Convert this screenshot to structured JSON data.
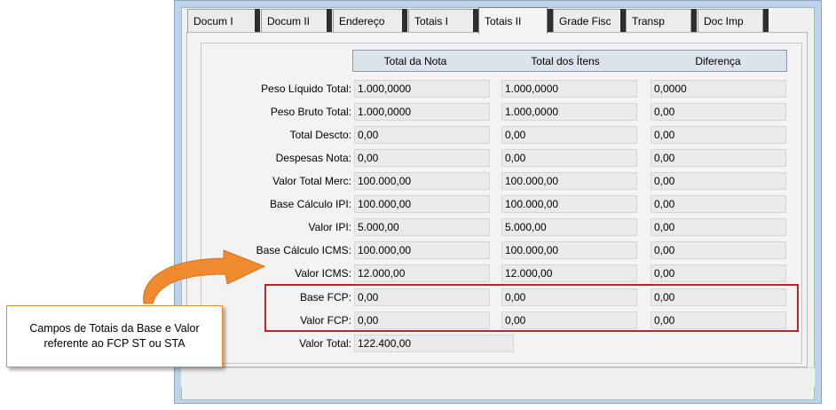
{
  "tabs": [
    {
      "label": "Docum I"
    },
    {
      "label": "Docum II"
    },
    {
      "label": "Endereço"
    },
    {
      "label": "Totais I"
    },
    {
      "label": "Totais II"
    },
    {
      "label": "Grade Fisc"
    },
    {
      "label": "Transp"
    },
    {
      "label": "Doc Imp"
    }
  ],
  "active_tab": "Totais II",
  "columns": {
    "total_nota": "Total da Nota",
    "total_itens": "Total dos Ítens",
    "diferenca": "Diferença"
  },
  "rows": [
    {
      "label": "Peso Líquido Total:",
      "nota": "1.000,0000",
      "itens": "1.000,0000",
      "dif": "0,0000"
    },
    {
      "label": "Peso Bruto Total:",
      "nota": "1.000,0000",
      "itens": "1.000,0000",
      "dif": "0,00"
    },
    {
      "label": "Total Descto:",
      "nota": "0,00",
      "itens": "0,00",
      "dif": "0,00"
    },
    {
      "label": "Despesas Nota:",
      "nota": "0,00",
      "itens": "0,00",
      "dif": "0,00"
    },
    {
      "label": "Valor Total Merc:",
      "nota": "100.000,00",
      "itens": "100.000,00",
      "dif": "0,00"
    },
    {
      "label": "Base Cálculo IPI:",
      "nota": "100.000,00",
      "itens": "100.000,00",
      "dif": "0,00"
    },
    {
      "label": "Valor IPI:",
      "nota": "5.000,00",
      "itens": "5.000,00",
      "dif": "0,00"
    },
    {
      "label": "Base Cálculo ICMS:",
      "nota": "100.000,00",
      "itens": "100.000,00",
      "dif": "0,00"
    },
    {
      "label": "Valor ICMS:",
      "nota": "12.000,00",
      "itens": "12.000,00",
      "dif": "0,00"
    },
    {
      "label": "Base FCP:",
      "nota": "0,00",
      "itens": "0,00",
      "dif": "0,00"
    },
    {
      "label": "Valor FCP:",
      "nota": "0,00",
      "itens": "0,00",
      "dif": "0,00"
    }
  ],
  "valor_total": {
    "label": "Valor Total:",
    "value": "122.400,00"
  },
  "callout": {
    "text": "Campos de Totais da Base e Valor referente ao FCP ST ou STA"
  },
  "colors": {
    "highlight": "#b9272c",
    "callout_arrow": "#f08a2e",
    "window_frame": "#bcd3ea"
  }
}
